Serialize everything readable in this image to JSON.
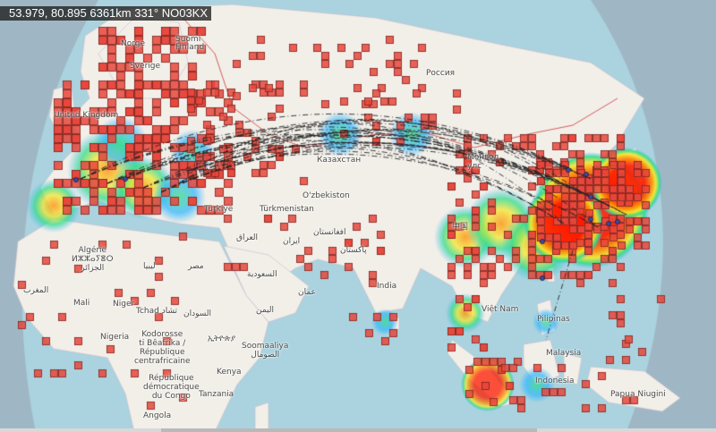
{
  "header": {
    "coordinate_readout": "53.979, 80.895 6361km 331° NO03KX"
  },
  "map": {
    "night_shade_color": "#9fb7c4",
    "land_color": "#f2efe9",
    "water_color": "#aad3df",
    "grid_cell_fill": "#e8473c",
    "grid_cell_stroke": "#5a1f1a",
    "path_color": "#222222",
    "heat_colors": [
      "#39b8ff",
      "#33dd88",
      "#f5e830",
      "#ff8a00",
      "#ff1a00"
    ],
    "labels": {
      "norge": "Norge",
      "suomi_finland": "Suomi\nFinland",
      "sverige": "Sverige",
      "united_kingdom": "United Kingdom",
      "rossiya": "Россия",
      "kazakhstan": "Казахстан",
      "mongolia": "Монгол\nулс",
      "uzbekistan": "O'zbekiston",
      "turkmenistan": "Türkmenistan",
      "turkiye": "Türkiye",
      "iraq": "العراق",
      "iran": "ایران",
      "afghanistan": "افغانستان",
      "pakistan": "پاکستان",
      "algerie": "Algérie\nⵍⵣⵣⴰⵢⴻⵔ\nالجزائر",
      "libya": "ليبيا",
      "misr": "مصر",
      "maroc": "المغرب",
      "saudi": "السعودية",
      "oman": "عمان",
      "yemen": "اليمن",
      "india": "India",
      "mali": "Mali",
      "niger": "Niger",
      "tchad": "Tchad تشاد",
      "sudan": "السودان",
      "nigeria": "Nigeria",
      "ethiopia": "ኢትዮጵያ",
      "somalia": "Soomaaliya\nالصومال",
      "cote_ivoire": "Kodorosse\nti Bêafrika /\nRépublique\ncentrafricaine",
      "kenya": "Kenya",
      "rdc": "République\ndémocratique\ndu Congo",
      "tanzania": "Tanzania",
      "angola": "Angola",
      "zhongguo": "中国",
      "viet_nam": "Việt Nam",
      "pilipinas": "Pilipinas",
      "malaysia": "Malaysia",
      "indonesia": "Indonesia",
      "papua": "Papua Niugini"
    }
  }
}
